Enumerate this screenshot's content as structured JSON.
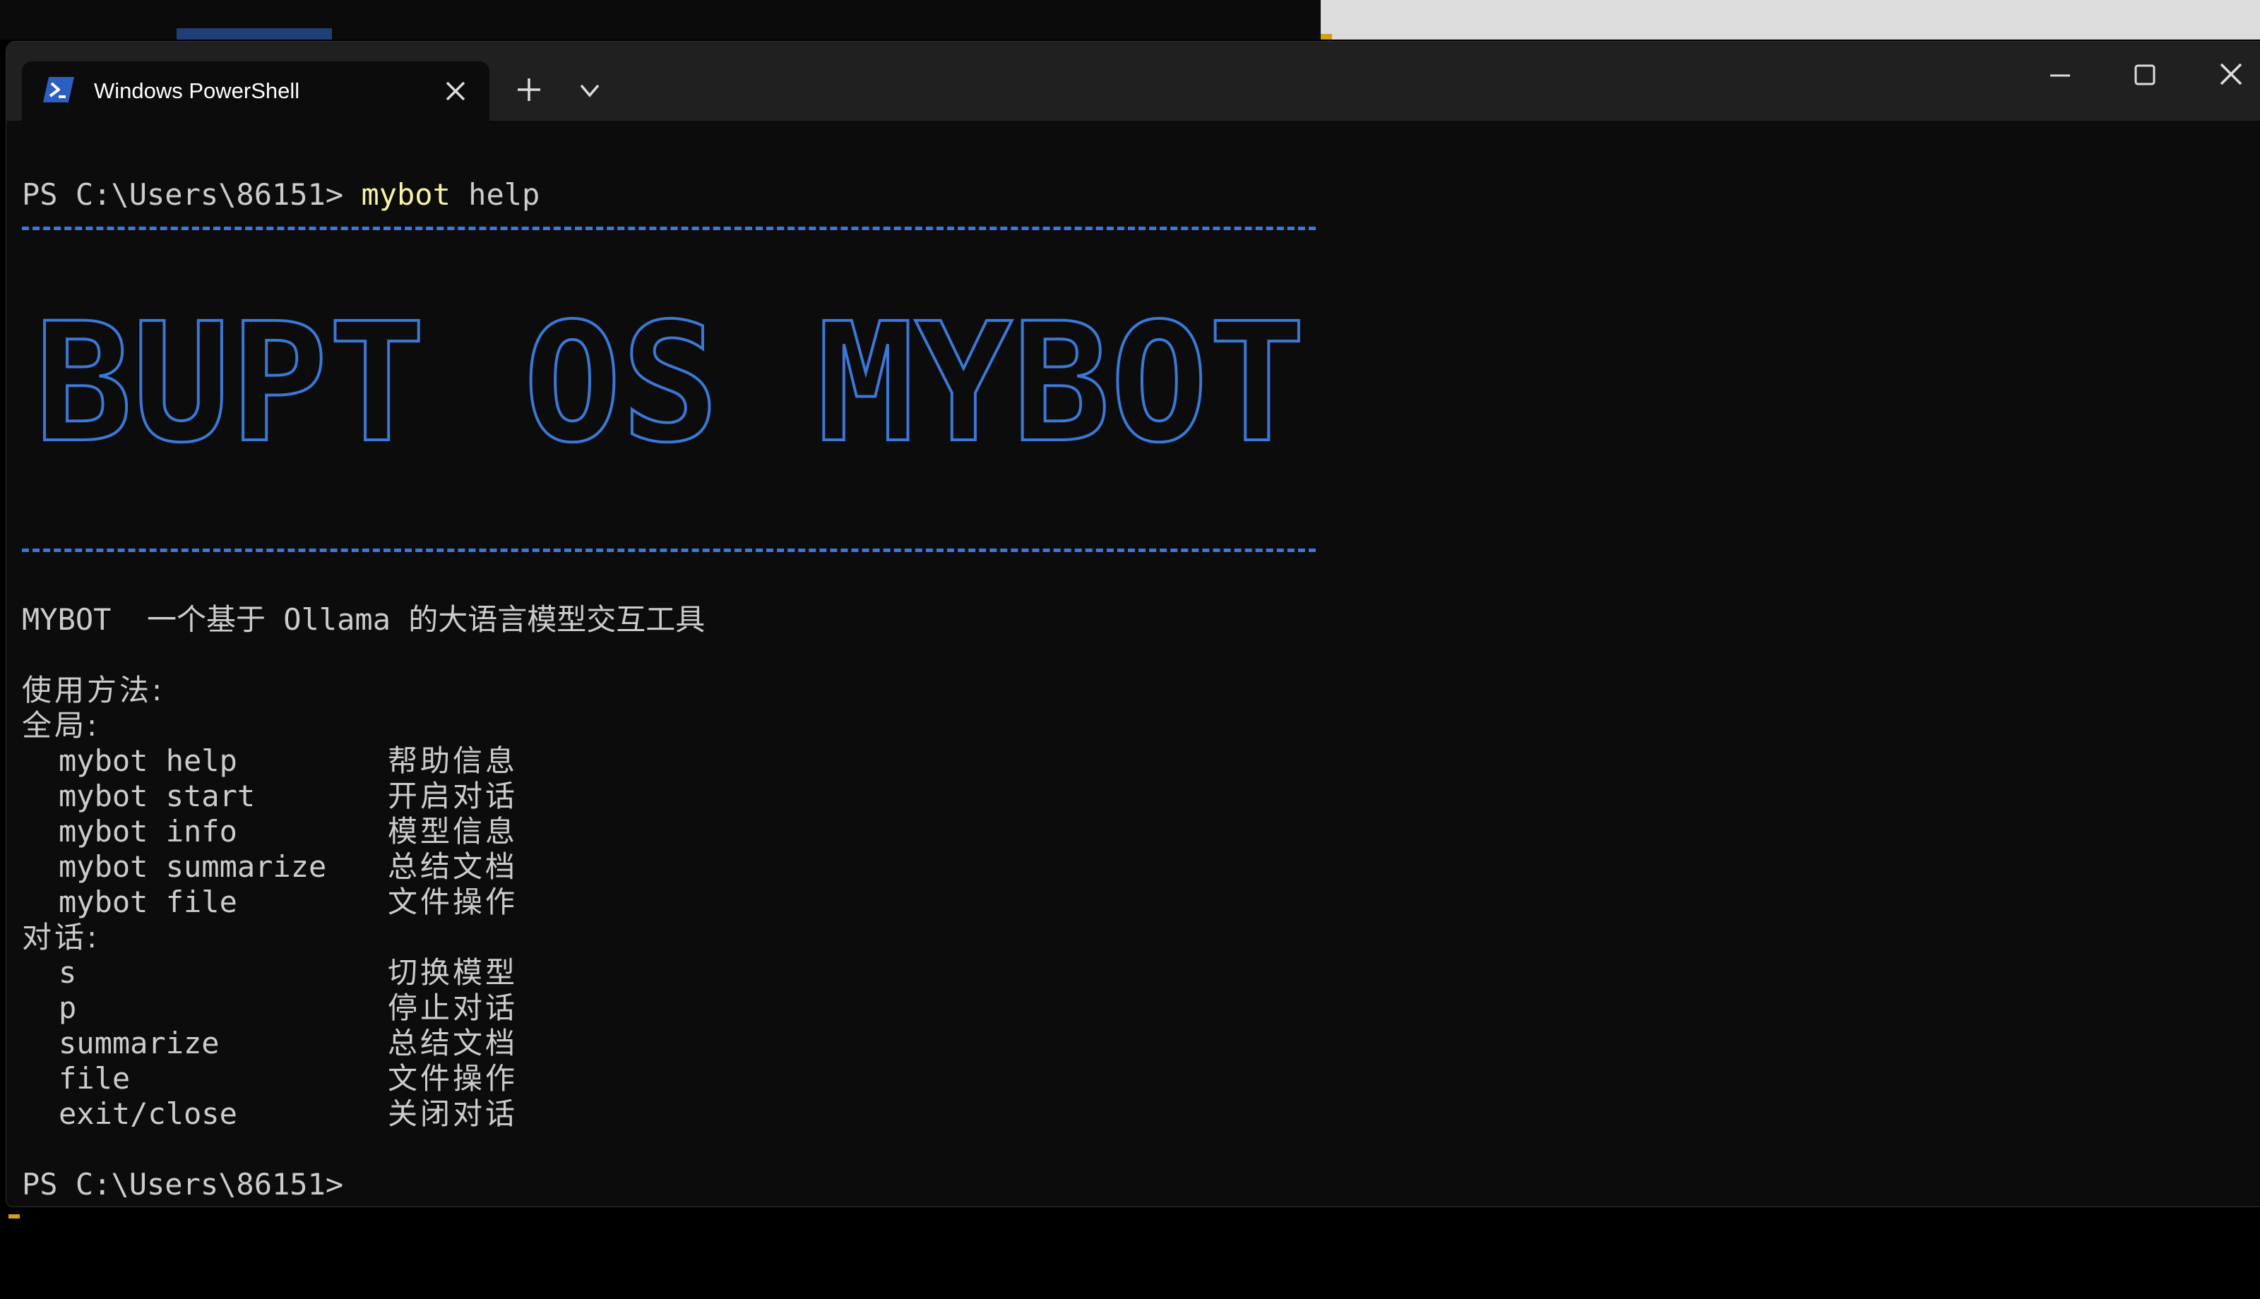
{
  "window": {
    "tab_title": "Windows PowerShell",
    "tab_icon": "powershell-icon",
    "new_tab_icon": "plus-icon",
    "dropdown_icon": "chevron-down-icon",
    "controls": [
      "minimize-icon",
      "maximize-icon",
      "close-icon"
    ]
  },
  "terminal": {
    "prompt": "PS C:\\Users\\86151> ",
    "command": "mybot",
    "command_arg": " help",
    "banner_text": "BUPT OS MYBOT",
    "description": "MYBOT  一个基于 Ollama 的大语言模型交互工具",
    "usage_heading": "使用方法:",
    "global_heading": "全局:",
    "global_commands": [
      {
        "cmd": "mybot help",
        "desc": "帮助信息"
      },
      {
        "cmd": "mybot start",
        "desc": "开启对话"
      },
      {
        "cmd": "mybot info",
        "desc": "模型信息"
      },
      {
        "cmd": "mybot summarize",
        "desc": "总结文档"
      },
      {
        "cmd": "mybot file",
        "desc": "文件操作"
      }
    ],
    "dialog_heading": "对话:",
    "dialog_commands": [
      {
        "cmd": "s",
        "desc": "切换模型"
      },
      {
        "cmd": "p",
        "desc": "停止对话"
      },
      {
        "cmd": "summarize",
        "desc": "总结文档"
      },
      {
        "cmd": "file",
        "desc": "文件操作"
      },
      {
        "cmd": "exit/close",
        "desc": "关闭对话"
      }
    ],
    "final_prompt": "PS C:\\Users\\86151>"
  },
  "colors": {
    "background": "#0c0c0c",
    "titlebar": "#202020",
    "text": "#cccccc",
    "command_highlight": "#f9f1a5",
    "banner_blue": "#3b78d8"
  }
}
